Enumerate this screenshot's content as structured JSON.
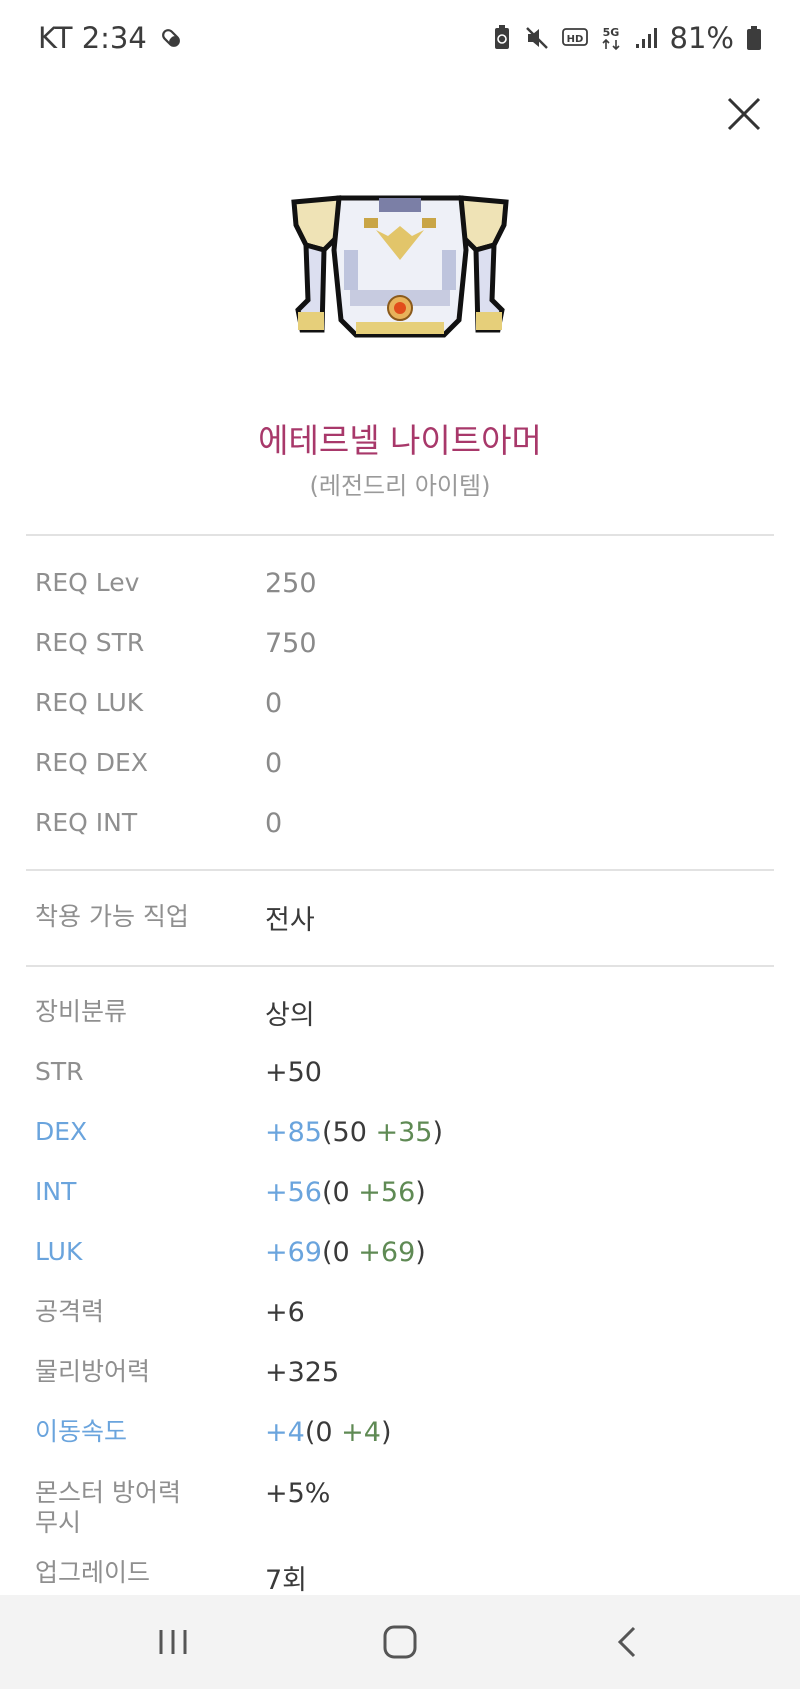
{
  "status_bar": {
    "time": "KT 2:34",
    "battery": "81%",
    "icons": [
      "pill-icon",
      "battery-saver-icon",
      "mute-icon",
      "hd-icon",
      "5g-icon",
      "signal-icon",
      "battery-icon"
    ]
  },
  "item": {
    "name": "에테르넬 나이트아머",
    "grade": "(레전드리 아이템)",
    "name_color": "#a8386a"
  },
  "requirements": [
    {
      "label": "REQ Lev",
      "value": "250"
    },
    {
      "label": "REQ STR",
      "value": "750"
    },
    {
      "label": "REQ LUK",
      "value": "0"
    },
    {
      "label": "REQ DEX",
      "value": "0"
    },
    {
      "label": "REQ INT",
      "value": "0"
    }
  ],
  "job": {
    "label": "착용 가능 직업",
    "value": "전사"
  },
  "stats": {
    "category": {
      "label": "장비분류",
      "value": "상의"
    },
    "str": {
      "label": "STR",
      "value": "+50"
    },
    "dex": {
      "label": "DEX",
      "total": "+85",
      "open": "(",
      "base": "50 ",
      "bonus": "+35",
      "close": ")"
    },
    "int": {
      "label": "INT",
      "total": "+56",
      "open": "(",
      "base": "0 ",
      "bonus": "+56",
      "close": ")"
    },
    "luk": {
      "label": "LUK",
      "total": "+69",
      "open": "(",
      "base": "0 ",
      "bonus": "+69",
      "close": ")"
    },
    "attack": {
      "label": "공격력",
      "value": "+6"
    },
    "phys_def": {
      "label": "물리방어력",
      "value": "+325"
    },
    "speed": {
      "label": "이동속도",
      "total": "+4",
      "open": "(",
      "base": "0 ",
      "bonus": "+4",
      "close": ")"
    },
    "ignore_def": {
      "label_line1": "몬스터 방어력",
      "label_line2": "무시",
      "value": "+5%"
    },
    "upgrade": {
      "label": "업그레이드",
      "value": "7회"
    }
  },
  "colors": {
    "accent_blue": "#6aa4dd",
    "bonus_green": "#5f8a54",
    "label_gray": "#8f8f8f"
  }
}
